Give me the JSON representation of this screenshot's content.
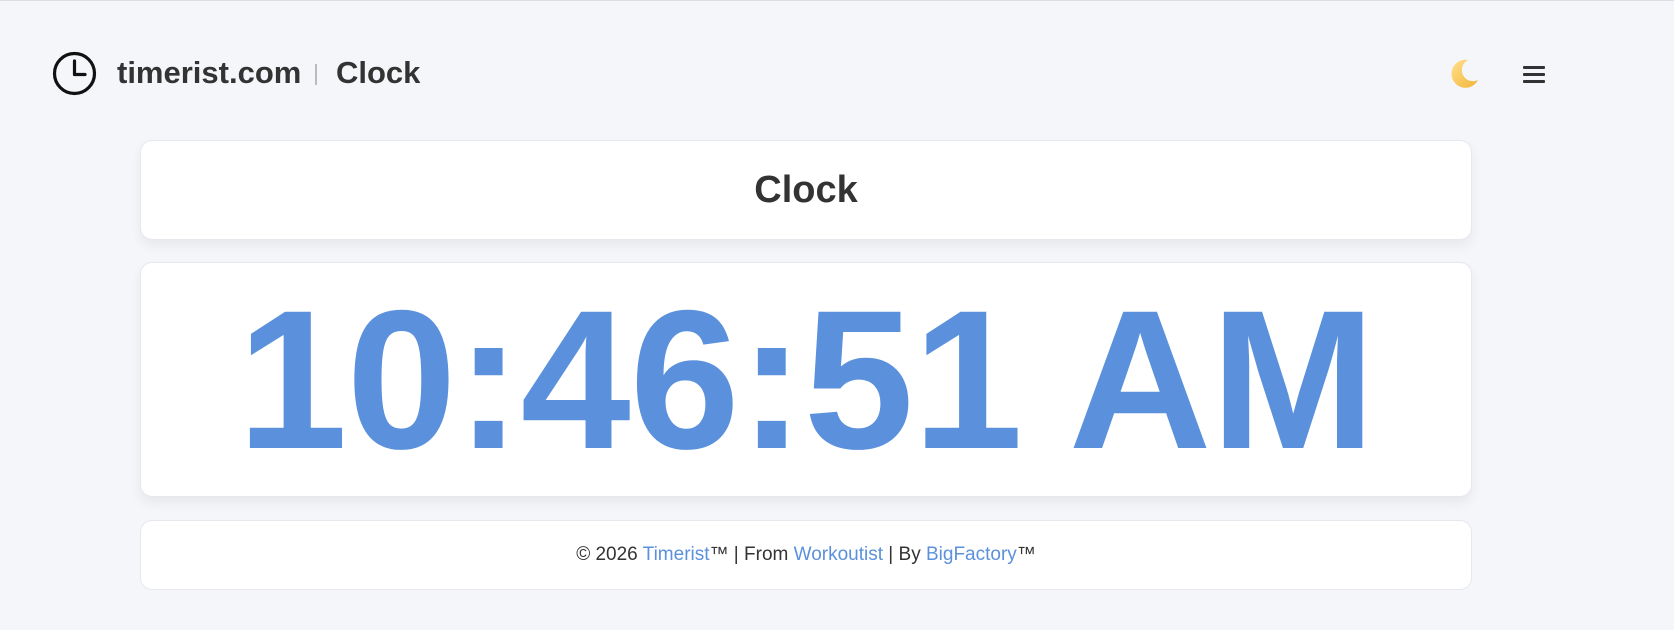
{
  "header": {
    "logo_icon": "clock-icon",
    "brand": "timerist.com",
    "page_name": "Clock",
    "theme_toggle_icon": "moon-icon",
    "menu_icon": "hamburger-menu-icon"
  },
  "main": {
    "title": "Clock",
    "time": "10:46:51 AM"
  },
  "footer": {
    "copyright": "© 2026 ",
    "link_timerist": "Timerist",
    "tm1": "™ | From ",
    "link_workoutist": "Workoutist",
    "by": " | By ",
    "link_bigfactory": "BigFactory",
    "tm2": "™"
  },
  "colors": {
    "accent": "#5b91dc",
    "text": "#333333",
    "background": "#f5f6fa",
    "card": "#ffffff"
  }
}
